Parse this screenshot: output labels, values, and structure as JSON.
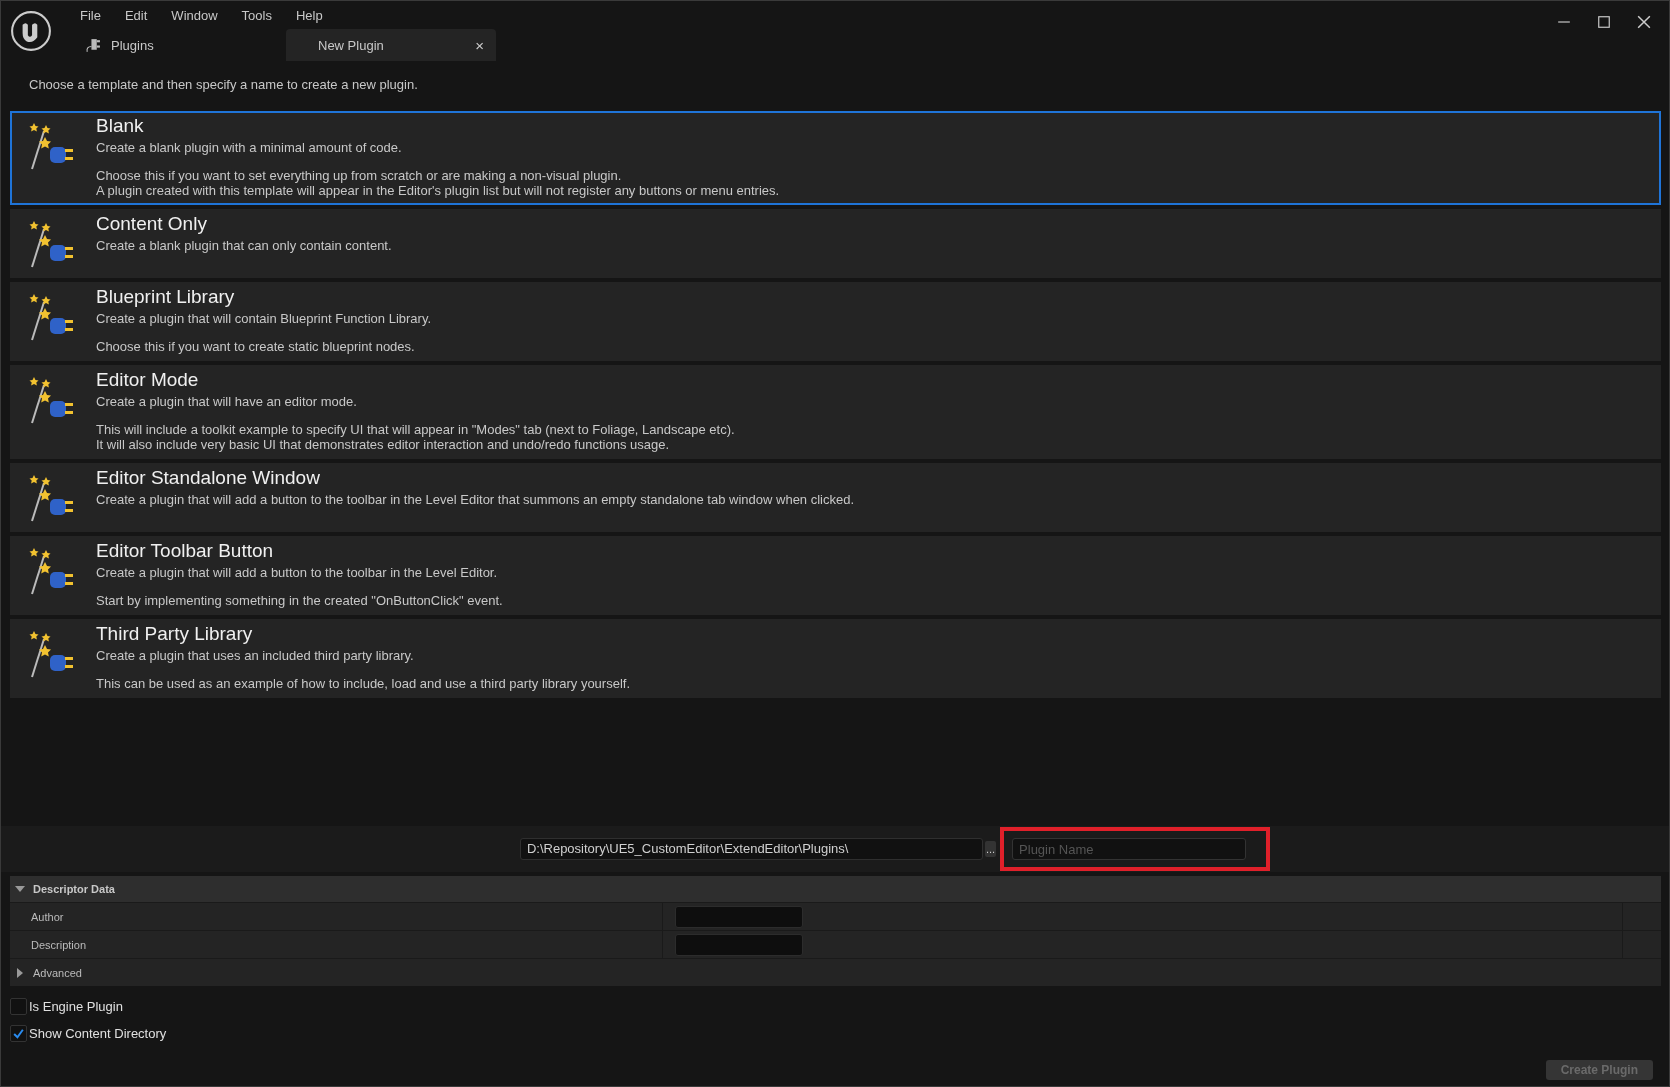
{
  "menu": [
    "File",
    "Edit",
    "Window",
    "Tools",
    "Help"
  ],
  "tabs": [
    {
      "label": "Plugins",
      "selected": false
    },
    {
      "label": "New Plugin",
      "selected": true,
      "close": "×"
    }
  ],
  "intro": "Choose a template and then specify a name to create a new plugin.",
  "templates": [
    {
      "title": "Blank",
      "selected": true,
      "paragraphs": [
        [
          "Create a blank plugin with a minimal amount of code."
        ],
        [
          "Choose this if you want to set everything up from scratch or are making a non-visual plugin.",
          "A plugin created with this template will appear in the Editor's plugin list but will not register any buttons or menu entries."
        ]
      ]
    },
    {
      "title": "Content Only",
      "selected": false,
      "paragraphs": [
        [
          "Create a blank plugin that can only contain content."
        ]
      ]
    },
    {
      "title": "Blueprint Library",
      "selected": false,
      "paragraphs": [
        [
          "Create a plugin that will contain Blueprint Function Library."
        ],
        [
          "Choose this if you want to create static blueprint nodes."
        ]
      ]
    },
    {
      "title": "Editor Mode",
      "selected": false,
      "paragraphs": [
        [
          "Create a plugin that will have an editor mode."
        ],
        [
          "This will include a toolkit example to specify UI that will appear in \"Modes\" tab (next to Foliage, Landscape etc).",
          "It will also include very basic UI that demonstrates editor interaction and undo/redo functions usage."
        ]
      ]
    },
    {
      "title": "Editor Standalone Window",
      "selected": false,
      "paragraphs": [
        [
          "Create a plugin that will add a button to the toolbar in the Level Editor that summons an empty standalone tab window when clicked."
        ]
      ]
    },
    {
      "title": "Editor Toolbar Button",
      "selected": false,
      "paragraphs": [
        [
          "Create a plugin that will add a button to the toolbar in the Level Editor."
        ],
        [
          "Start by implementing something in the created \"OnButtonClick\" event."
        ]
      ]
    },
    {
      "title": "Third Party Library",
      "selected": false,
      "paragraphs": [
        [
          "Create a plugin that uses an included third party library."
        ],
        [
          "This can be used as an example of how to include, load and use a third party library yourself."
        ]
      ]
    }
  ],
  "path": {
    "value": "D:\\Repository\\UE5_CustomEditor\\ExtendEditor\\Plugins\\",
    "browse": "..."
  },
  "plugin_name": {
    "placeholder": "Plugin Name",
    "highlighted": true
  },
  "descriptor": {
    "title": "Descriptor Data",
    "expanded": true,
    "fields": [
      {
        "label": "Author"
      },
      {
        "label": "Description"
      }
    ],
    "advanced": {
      "label": "Advanced",
      "expanded": false
    }
  },
  "options": [
    {
      "label": "Is Engine Plugin",
      "checked": false
    },
    {
      "label": "Show Content Directory",
      "checked": true
    }
  ],
  "create_button": {
    "label": "Create Plugin",
    "disabled": true
  }
}
